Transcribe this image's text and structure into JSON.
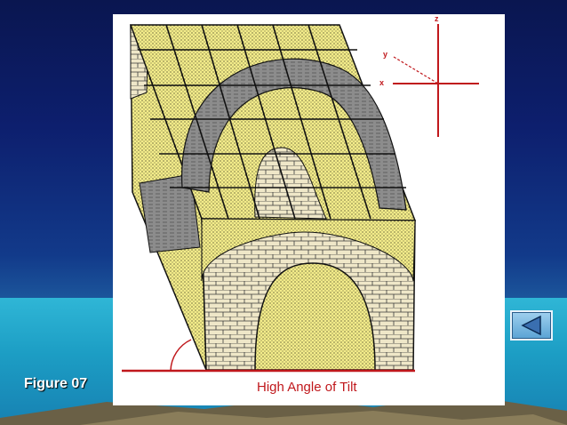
{
  "slide": {
    "figure_label": "Figure 07",
    "caption": "High Angle of Tilt",
    "axes": {
      "z": "z",
      "y": "y",
      "x": "x"
    },
    "colors": {
      "background_top": "#0a1650",
      "sea": "#1c9dc4",
      "sand_yellow": "#f3ec8a",
      "shale_gray": "#8c8c8c",
      "brick_tan": "#efe7c8",
      "accent_red": "#c0181c"
    }
  },
  "nav": {
    "back_icon": "triangle-left-icon"
  }
}
